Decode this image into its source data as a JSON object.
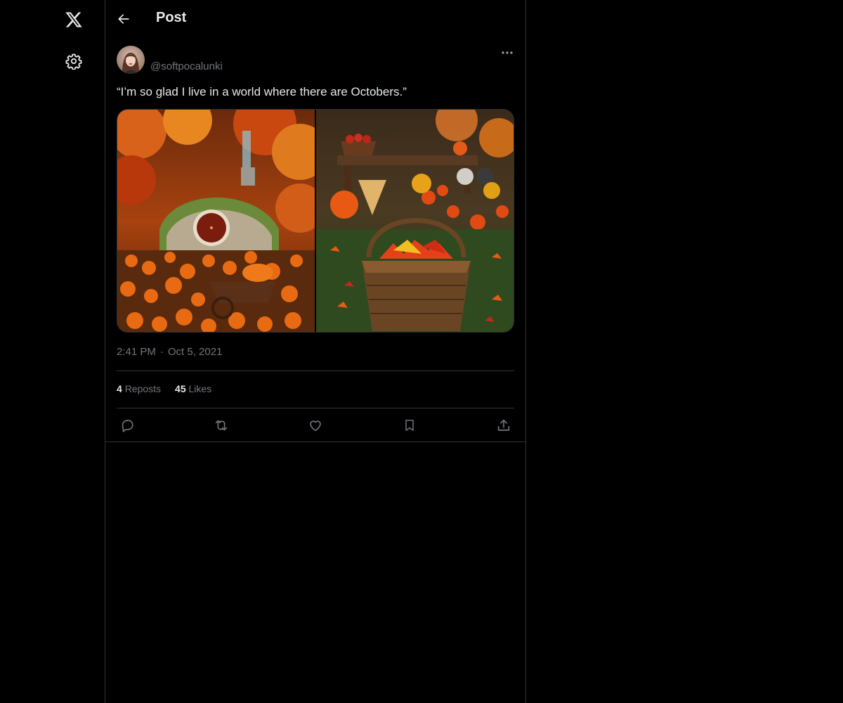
{
  "app": {
    "logo_icon": "x-logo-icon",
    "settings_icon": "gear-icon"
  },
  "header": {
    "title": "Post",
    "back_icon": "arrow-left-icon"
  },
  "post": {
    "handle": "@softpocalunki",
    "text": "“I’m so glad I live in a world where there are Octobers.”",
    "time": "2:41 PM",
    "separator": "·",
    "date": "Oct 5, 2021",
    "media": [
      {
        "icon": "autumn-hobbit-house-image"
      },
      {
        "icon": "autumn-basket-image"
      }
    ],
    "stats": {
      "reposts_count": "4",
      "reposts_label": "Reposts",
      "likes_count": "45",
      "likes_label": "Likes"
    },
    "actions": [
      {
        "icon": "reply-icon"
      },
      {
        "icon": "repost-icon"
      },
      {
        "icon": "like-icon"
      },
      {
        "icon": "bookmark-icon"
      },
      {
        "icon": "share-icon"
      }
    ]
  },
  "colors": {
    "background": "#000000",
    "text_primary": "#e7e9ea",
    "text_secondary": "#71767b",
    "border": "#2f3336"
  }
}
